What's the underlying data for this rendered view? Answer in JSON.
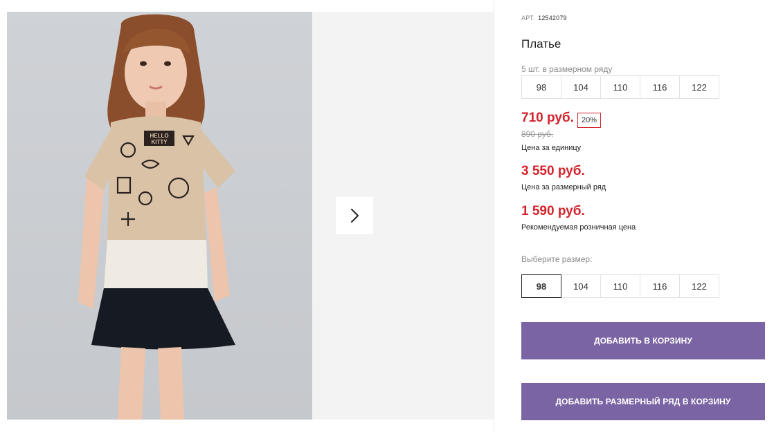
{
  "product": {
    "art_label": "АРТ.",
    "art_value": "12542079",
    "title": "Платье",
    "series_label": "5 шт. в размерном ряду",
    "series_sizes": [
      "98",
      "104",
      "110",
      "116",
      "122"
    ],
    "price": "710 руб.",
    "discount": "20%",
    "old_price": "890 руб.",
    "unit_price_label": "Цена за единицу",
    "series_price": "3 550 руб.",
    "series_price_label": "Цена за размерный ряд",
    "rrp_price": "1 590 руб.",
    "rrp_label": "Рекомендуемая розничная цена",
    "choose_size_label": "Выберите размер:",
    "sizes": [
      "98",
      "104",
      "110",
      "116",
      "122"
    ],
    "selected_size": "98"
  },
  "buttons": {
    "add_to_cart": "ДОБАВИТЬ В КОРЗИНУ",
    "add_series_to_cart": "ДОБАВИТЬ РАЗМЕРНЫЙ РЯД В КОРЗИНУ"
  },
  "gallery": {
    "next_icon": "chevron-right-icon"
  },
  "colors": {
    "accent_price": "#d4222b",
    "button": "#7b64a4"
  },
  "photo_print": {
    "brand_1": "HELLO",
    "brand_2": "KITTY"
  }
}
